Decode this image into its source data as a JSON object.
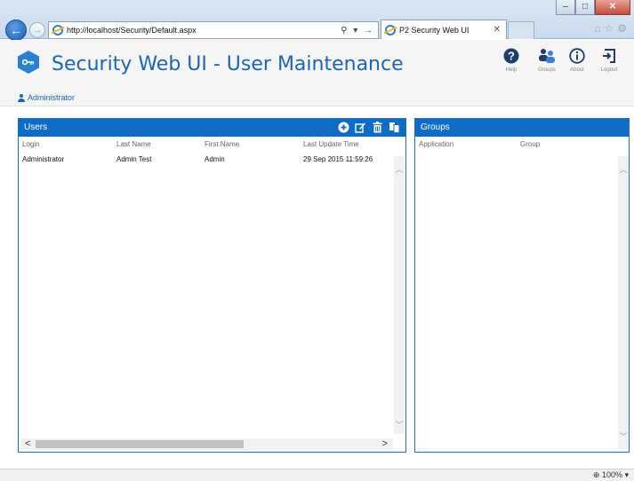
{
  "browser": {
    "url": "http://localhost/Security/Default.aspx",
    "tab_title": "P2 Security Web UI",
    "zoom": "100%"
  },
  "app": {
    "title": "Security Web UI - User Maintenance",
    "current_user": "Administrator",
    "accent_color": "#0f6cc4",
    "nav": [
      {
        "label": "Help",
        "icon": "help-icon"
      },
      {
        "label": "Groups",
        "icon": "groups-icon"
      },
      {
        "label": "About",
        "icon": "info-icon"
      },
      {
        "label": "Logout",
        "icon": "logout-icon"
      }
    ]
  },
  "users_panel": {
    "title": "Users",
    "toolbar_icons": [
      "add-icon",
      "edit-icon",
      "delete-icon",
      "copy-icon"
    ],
    "columns": [
      "Login",
      "Last Name",
      "First Name",
      "Last Update Time"
    ],
    "rows": [
      [
        "Administrator",
        "Admin Test",
        "Admin",
        "29 Sep 2015 11:59:26"
      ]
    ]
  },
  "groups_panel": {
    "title": "Groups",
    "columns": [
      "Application",
      "Group"
    ],
    "rows": []
  }
}
